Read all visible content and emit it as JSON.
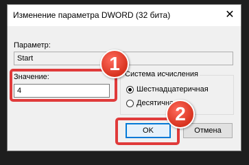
{
  "dialog": {
    "title": "Изменение параметра DWORD (32 бита)",
    "close_glyph": "✕"
  },
  "parameter": {
    "label": "Параметр:",
    "value": "Start"
  },
  "value": {
    "label": "Значение:",
    "value": "4"
  },
  "base": {
    "legend": "Система исчисления",
    "options": [
      {
        "label": "Шестнадцатеричная",
        "checked": true
      },
      {
        "label": "Десятичная",
        "checked": false
      }
    ]
  },
  "buttons": {
    "ok": "OK",
    "cancel": "Отмена"
  },
  "annotations": {
    "badge1": "1",
    "badge2": "2",
    "color": "#e03a3a"
  }
}
